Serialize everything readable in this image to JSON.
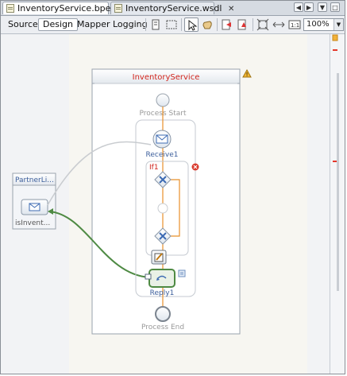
{
  "tabs": [
    {
      "label": "InventoryService.bpel *",
      "active": true
    },
    {
      "label": "InventoryService.wsdl",
      "active": false
    }
  ],
  "view_tabs": [
    {
      "label": "Source",
      "selected": false
    },
    {
      "label": "Design",
      "selected": true
    },
    {
      "label": "Mapper",
      "selected": false
    },
    {
      "label": "Logging",
      "selected": false
    }
  ],
  "zoom": {
    "value": "100%"
  },
  "diagram": {
    "process_name": "InventoryService",
    "partner_link_title": "PartnerLi...",
    "partner_link_name": "isInvent...",
    "process_start": "Process Start",
    "receive_label": "Receive1",
    "if_label": "If1",
    "reply_label": "Reply1",
    "process_end": "Process End"
  },
  "colors": {
    "accent_orange": "#e8902a",
    "link_green": "#4e8a43",
    "process_title_red": "#d0241c",
    "label_blue": "#3d5f9c",
    "error_red": "#d93a2d"
  }
}
